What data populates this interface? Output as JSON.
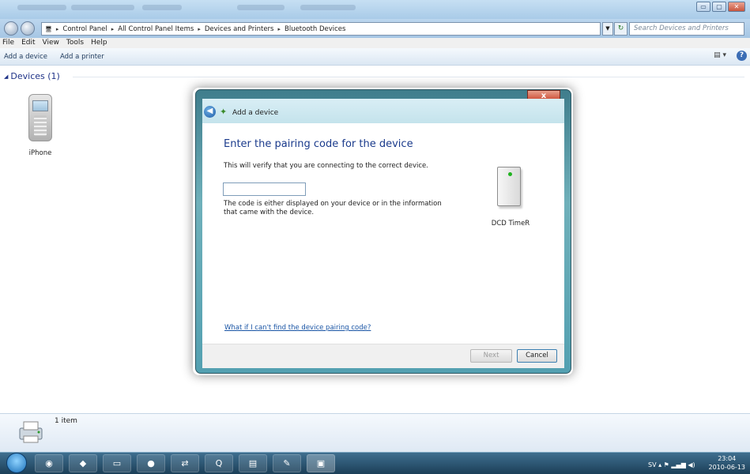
{
  "window": {
    "buttons": {
      "minimize": "▭",
      "maximize": "▢",
      "close": "✕"
    }
  },
  "address": {
    "path": [
      "Control Panel",
      "All Control Panel Items",
      "Devices and Printers",
      "Bluetooth Devices"
    ],
    "search_placeholder": "Search Devices and Printers"
  },
  "menu": [
    "File",
    "Edit",
    "View",
    "Tools",
    "Help"
  ],
  "toolbar": {
    "add_device": "Add a device",
    "add_printer": "Add a printer"
  },
  "content": {
    "group_title": "Devices (1)",
    "devices": [
      {
        "label": "iPhone",
        "icon": "phone-icon"
      }
    ]
  },
  "dialog": {
    "title": "Add a device",
    "heading": "Enter the pairing code for the device",
    "subtext": "This will verify that you are connecting to the correct device.",
    "input_value": "",
    "hint": "The code is either displayed on your device or in the information that came with the device.",
    "device_label": "DCD TimeR",
    "help_link": "What if I can't find the device pairing code?",
    "next_label": "Next",
    "cancel_label": "Cancel",
    "close_glyph": "x"
  },
  "details": {
    "count": "1 item"
  },
  "taskbar": {
    "apps": [
      "ie-icon",
      "firefox-icon",
      "media-icon",
      "folder-icon",
      "spotify-icon",
      "network-icon",
      "qt-icon",
      "notepad-icon",
      "paint-icon",
      "controlpanel-icon"
    ],
    "tray_lang": "SV",
    "time": "23:04",
    "date": "2010-06-13"
  },
  "colors": {
    "accent": "#1b3b8c",
    "link": "#1a55a5",
    "dialog_frame": "#53a0b1"
  }
}
